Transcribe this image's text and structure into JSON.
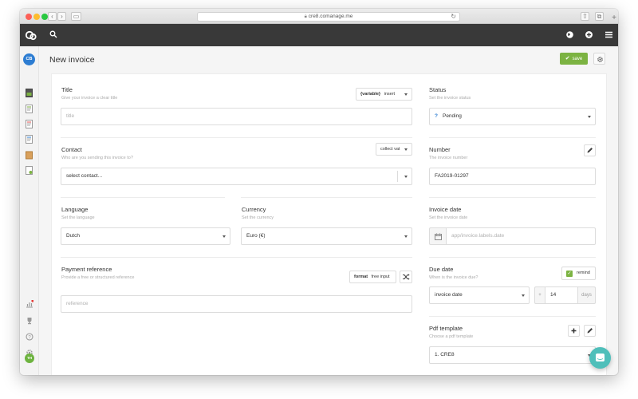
{
  "browser": {
    "url": "cre8.comanage.me"
  },
  "sidebar": {
    "avatar_initials": "CB",
    "user_initials": "TH"
  },
  "header": {
    "title": "New invoice",
    "save_label": "save"
  },
  "form": {
    "title": {
      "label": "Title",
      "hint": "Give your invoice a clear title",
      "placeholder": "title",
      "variable_label": "{variable}",
      "insert_label": "insert"
    },
    "status": {
      "label": "Status",
      "hint": "Set the invoice status",
      "icon_char": "?",
      "value": "Pending"
    },
    "contact": {
      "label": "Contact",
      "hint": "Who are you sending this invoice to?",
      "placeholder": "select contact...",
      "collect_label": "collect vat"
    },
    "number": {
      "label": "Number",
      "hint": "The invoice number",
      "value": "FA2019-01297"
    },
    "language": {
      "label": "Language",
      "hint": "Set the language",
      "value": "Dutch"
    },
    "currency": {
      "label": "Currency",
      "hint": "Set the currency",
      "value": "Euro (€)"
    },
    "invoice_date": {
      "label": "Invoice date",
      "hint": "Set the invoice date",
      "placeholder": "app/invoice.labels.date"
    },
    "payment_reference": {
      "label": "Payment reference",
      "hint": "Provide a free or structured reference",
      "placeholder": "reference",
      "format_label": "format",
      "free_input_label": "free input"
    },
    "due_date": {
      "label": "Due date",
      "hint": "When is the invoice due?",
      "remind_label": "remind",
      "base_value": "invoice date",
      "operator": "+",
      "days_value": "14",
      "days_unit": "days"
    },
    "pdf_template": {
      "label": "Pdf template",
      "hint": "Choose a pdf template",
      "value": "1. CRE8"
    }
  },
  "colors": {
    "topbar": "#393939",
    "save_green": "#7cb342",
    "avatar_blue": "#2d7dd2",
    "chat_teal": "#4fbfba"
  }
}
